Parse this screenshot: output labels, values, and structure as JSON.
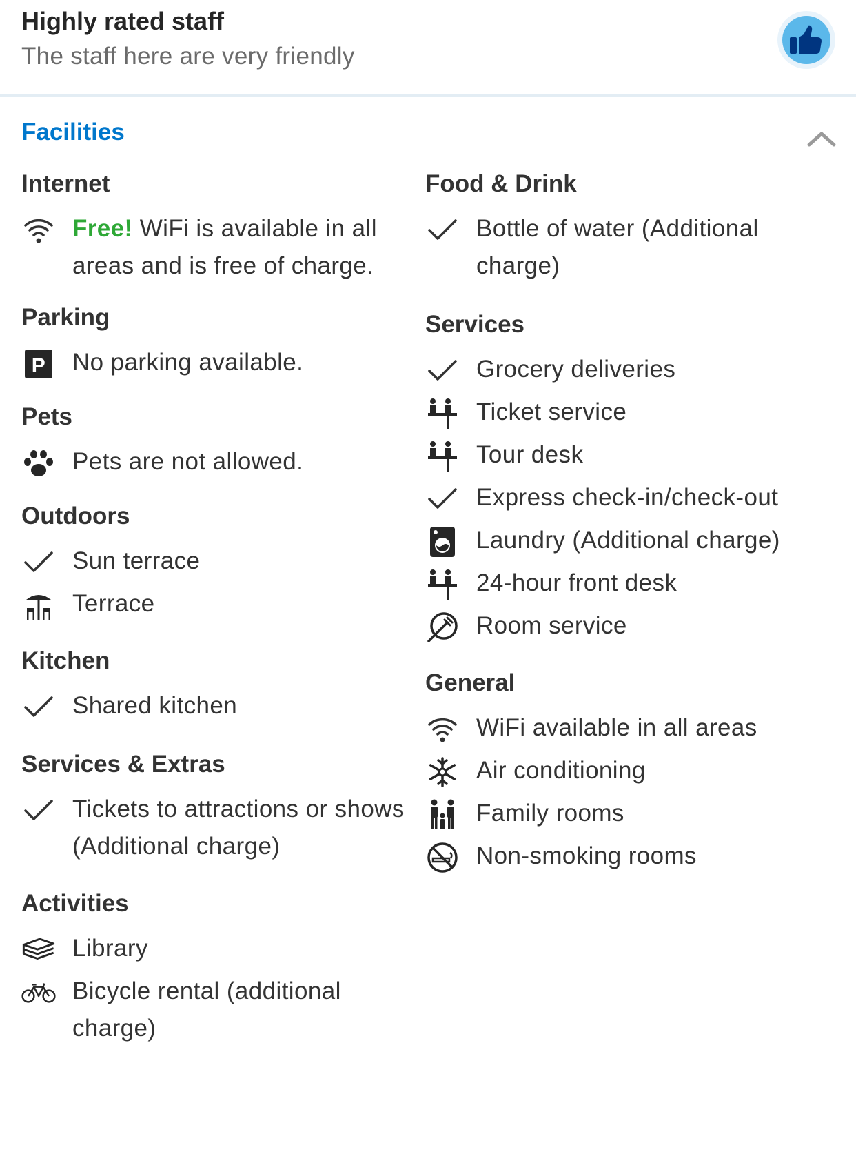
{
  "header": {
    "title": "Highly rated staff",
    "subtitle": "The staff here are very friendly",
    "badge_icon": "thumbs-up-icon"
  },
  "facilities": {
    "title": "Facilities",
    "toggle_icon": "chevron-up-icon"
  },
  "left_column": [
    {
      "title": "Internet",
      "items": [
        {
          "icon": "wifi-icon",
          "highlight": "Free!",
          "text": " WiFi is available in all areas and is free of charge."
        }
      ]
    },
    {
      "title": "Parking",
      "items": [
        {
          "icon": "parking-icon",
          "text": "No parking available."
        }
      ]
    },
    {
      "title": "Pets",
      "items": [
        {
          "icon": "paw-icon",
          "text": "Pets are not allowed."
        }
      ]
    },
    {
      "title": "Outdoors",
      "items": [
        {
          "icon": "check-icon",
          "text": "Sun terrace"
        },
        {
          "icon": "terrace-icon",
          "text": "Terrace"
        }
      ]
    },
    {
      "title": "Kitchen",
      "items": [
        {
          "icon": "check-icon",
          "text": "Shared kitchen"
        }
      ]
    },
    {
      "title": "Services & Extras",
      "items": [
        {
          "icon": "check-icon",
          "text": "Tickets to attractions or shows (Additional charge)"
        }
      ]
    },
    {
      "title": "Activities",
      "items": [
        {
          "icon": "books-icon",
          "text": "Library"
        },
        {
          "icon": "bicycle-icon",
          "text": "Bicycle rental (additional charge)"
        }
      ]
    }
  ],
  "right_column": [
    {
      "title": "Food & Drink",
      "items": [
        {
          "icon": "check-icon",
          "text": "Bottle of water (Additional charge)"
        }
      ]
    },
    {
      "title": "Services",
      "items": [
        {
          "icon": "check-icon",
          "text": "Grocery deliveries"
        },
        {
          "icon": "reception-icon",
          "text": "Ticket service"
        },
        {
          "icon": "reception-icon",
          "text": "Tour desk"
        },
        {
          "icon": "check-icon",
          "text": "Express check-in/check-out"
        },
        {
          "icon": "washing-machine-icon",
          "text": "Laundry (Additional charge)"
        },
        {
          "icon": "reception-icon",
          "text": "24-hour front desk"
        },
        {
          "icon": "room-service-icon",
          "text": "Room service"
        }
      ]
    },
    {
      "title": "General",
      "items": [
        {
          "icon": "wifi-icon",
          "text": "WiFi available in all areas"
        },
        {
          "icon": "snowflake-icon",
          "text": "Air conditioning"
        },
        {
          "icon": "family-icon",
          "text": "Family rooms"
        },
        {
          "icon": "no-smoking-icon",
          "text": "Non-smoking rooms"
        }
      ]
    }
  ]
}
